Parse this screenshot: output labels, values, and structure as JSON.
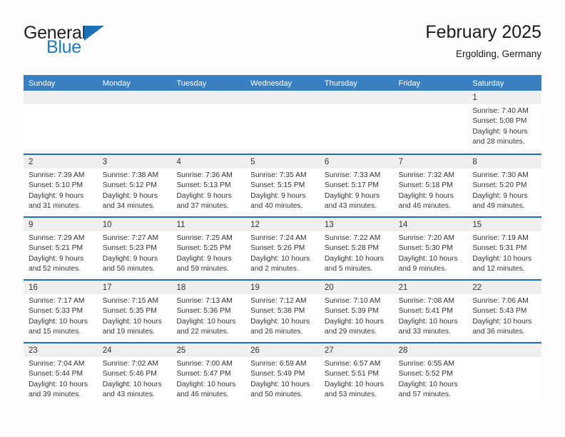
{
  "brand": {
    "name_part1": "General",
    "name_part2": "Blue",
    "logo_icon": "triangle-logo-icon"
  },
  "header": {
    "title": "February 2025",
    "location": "Ergolding, Germany"
  },
  "colors": {
    "header_blue": "#3880c2",
    "row_divider_blue": "#1f6db5",
    "day_band_gray": "#efefef",
    "brand_blue": "#1f7ac4",
    "text": "#333333"
  },
  "calendar": {
    "weekday_headers": [
      "Sunday",
      "Monday",
      "Tuesday",
      "Wednesday",
      "Thursday",
      "Friday",
      "Saturday"
    ],
    "weeks": [
      [
        {
          "day": "",
          "lines": []
        },
        {
          "day": "",
          "lines": []
        },
        {
          "day": "",
          "lines": []
        },
        {
          "day": "",
          "lines": []
        },
        {
          "day": "",
          "lines": []
        },
        {
          "day": "",
          "lines": []
        },
        {
          "day": "1",
          "lines": [
            "Sunrise: 7:40 AM",
            "Sunset: 5:08 PM",
            "Daylight: 9 hours",
            "and 28 minutes."
          ]
        }
      ],
      [
        {
          "day": "2",
          "lines": [
            "Sunrise: 7:39 AM",
            "Sunset: 5:10 PM",
            "Daylight: 9 hours",
            "and 31 minutes."
          ]
        },
        {
          "day": "3",
          "lines": [
            "Sunrise: 7:38 AM",
            "Sunset: 5:12 PM",
            "Daylight: 9 hours",
            "and 34 minutes."
          ]
        },
        {
          "day": "4",
          "lines": [
            "Sunrise: 7:36 AM",
            "Sunset: 5:13 PM",
            "Daylight: 9 hours",
            "and 37 minutes."
          ]
        },
        {
          "day": "5",
          "lines": [
            "Sunrise: 7:35 AM",
            "Sunset: 5:15 PM",
            "Daylight: 9 hours",
            "and 40 minutes."
          ]
        },
        {
          "day": "6",
          "lines": [
            "Sunrise: 7:33 AM",
            "Sunset: 5:17 PM",
            "Daylight: 9 hours",
            "and 43 minutes."
          ]
        },
        {
          "day": "7",
          "lines": [
            "Sunrise: 7:32 AM",
            "Sunset: 5:18 PM",
            "Daylight: 9 hours",
            "and 46 minutes."
          ]
        },
        {
          "day": "8",
          "lines": [
            "Sunrise: 7:30 AM",
            "Sunset: 5:20 PM",
            "Daylight: 9 hours",
            "and 49 minutes."
          ]
        }
      ],
      [
        {
          "day": "9",
          "lines": [
            "Sunrise: 7:29 AM",
            "Sunset: 5:21 PM",
            "Daylight: 9 hours",
            "and 52 minutes."
          ]
        },
        {
          "day": "10",
          "lines": [
            "Sunrise: 7:27 AM",
            "Sunset: 5:23 PM",
            "Daylight: 9 hours",
            "and 56 minutes."
          ]
        },
        {
          "day": "11",
          "lines": [
            "Sunrise: 7:25 AM",
            "Sunset: 5:25 PM",
            "Daylight: 9 hours",
            "and 59 minutes."
          ]
        },
        {
          "day": "12",
          "lines": [
            "Sunrise: 7:24 AM",
            "Sunset: 5:26 PM",
            "Daylight: 10 hours",
            "and 2 minutes."
          ]
        },
        {
          "day": "13",
          "lines": [
            "Sunrise: 7:22 AM",
            "Sunset: 5:28 PM",
            "Daylight: 10 hours",
            "and 5 minutes."
          ]
        },
        {
          "day": "14",
          "lines": [
            "Sunrise: 7:20 AM",
            "Sunset: 5:30 PM",
            "Daylight: 10 hours",
            "and 9 minutes."
          ]
        },
        {
          "day": "15",
          "lines": [
            "Sunrise: 7:19 AM",
            "Sunset: 5:31 PM",
            "Daylight: 10 hours",
            "and 12 minutes."
          ]
        }
      ],
      [
        {
          "day": "16",
          "lines": [
            "Sunrise: 7:17 AM",
            "Sunset: 5:33 PM",
            "Daylight: 10 hours",
            "and 15 minutes."
          ]
        },
        {
          "day": "17",
          "lines": [
            "Sunrise: 7:15 AM",
            "Sunset: 5:35 PM",
            "Daylight: 10 hours",
            "and 19 minutes."
          ]
        },
        {
          "day": "18",
          "lines": [
            "Sunrise: 7:13 AM",
            "Sunset: 5:36 PM",
            "Daylight: 10 hours",
            "and 22 minutes."
          ]
        },
        {
          "day": "19",
          "lines": [
            "Sunrise: 7:12 AM",
            "Sunset: 5:38 PM",
            "Daylight: 10 hours",
            "and 26 minutes."
          ]
        },
        {
          "day": "20",
          "lines": [
            "Sunrise: 7:10 AM",
            "Sunset: 5:39 PM",
            "Daylight: 10 hours",
            "and 29 minutes."
          ]
        },
        {
          "day": "21",
          "lines": [
            "Sunrise: 7:08 AM",
            "Sunset: 5:41 PM",
            "Daylight: 10 hours",
            "and 33 minutes."
          ]
        },
        {
          "day": "22",
          "lines": [
            "Sunrise: 7:06 AM",
            "Sunset: 5:43 PM",
            "Daylight: 10 hours",
            "and 36 minutes."
          ]
        }
      ],
      [
        {
          "day": "23",
          "lines": [
            "Sunrise: 7:04 AM",
            "Sunset: 5:44 PM",
            "Daylight: 10 hours",
            "and 39 minutes."
          ]
        },
        {
          "day": "24",
          "lines": [
            "Sunrise: 7:02 AM",
            "Sunset: 5:46 PM",
            "Daylight: 10 hours",
            "and 43 minutes."
          ]
        },
        {
          "day": "25",
          "lines": [
            "Sunrise: 7:00 AM",
            "Sunset: 5:47 PM",
            "Daylight: 10 hours",
            "and 46 minutes."
          ]
        },
        {
          "day": "26",
          "lines": [
            "Sunrise: 6:59 AM",
            "Sunset: 5:49 PM",
            "Daylight: 10 hours",
            "and 50 minutes."
          ]
        },
        {
          "day": "27",
          "lines": [
            "Sunrise: 6:57 AM",
            "Sunset: 5:51 PM",
            "Daylight: 10 hours",
            "and 53 minutes."
          ]
        },
        {
          "day": "28",
          "lines": [
            "Sunrise: 6:55 AM",
            "Sunset: 5:52 PM",
            "Daylight: 10 hours",
            "and 57 minutes."
          ]
        },
        {
          "day": "",
          "lines": []
        }
      ]
    ]
  }
}
